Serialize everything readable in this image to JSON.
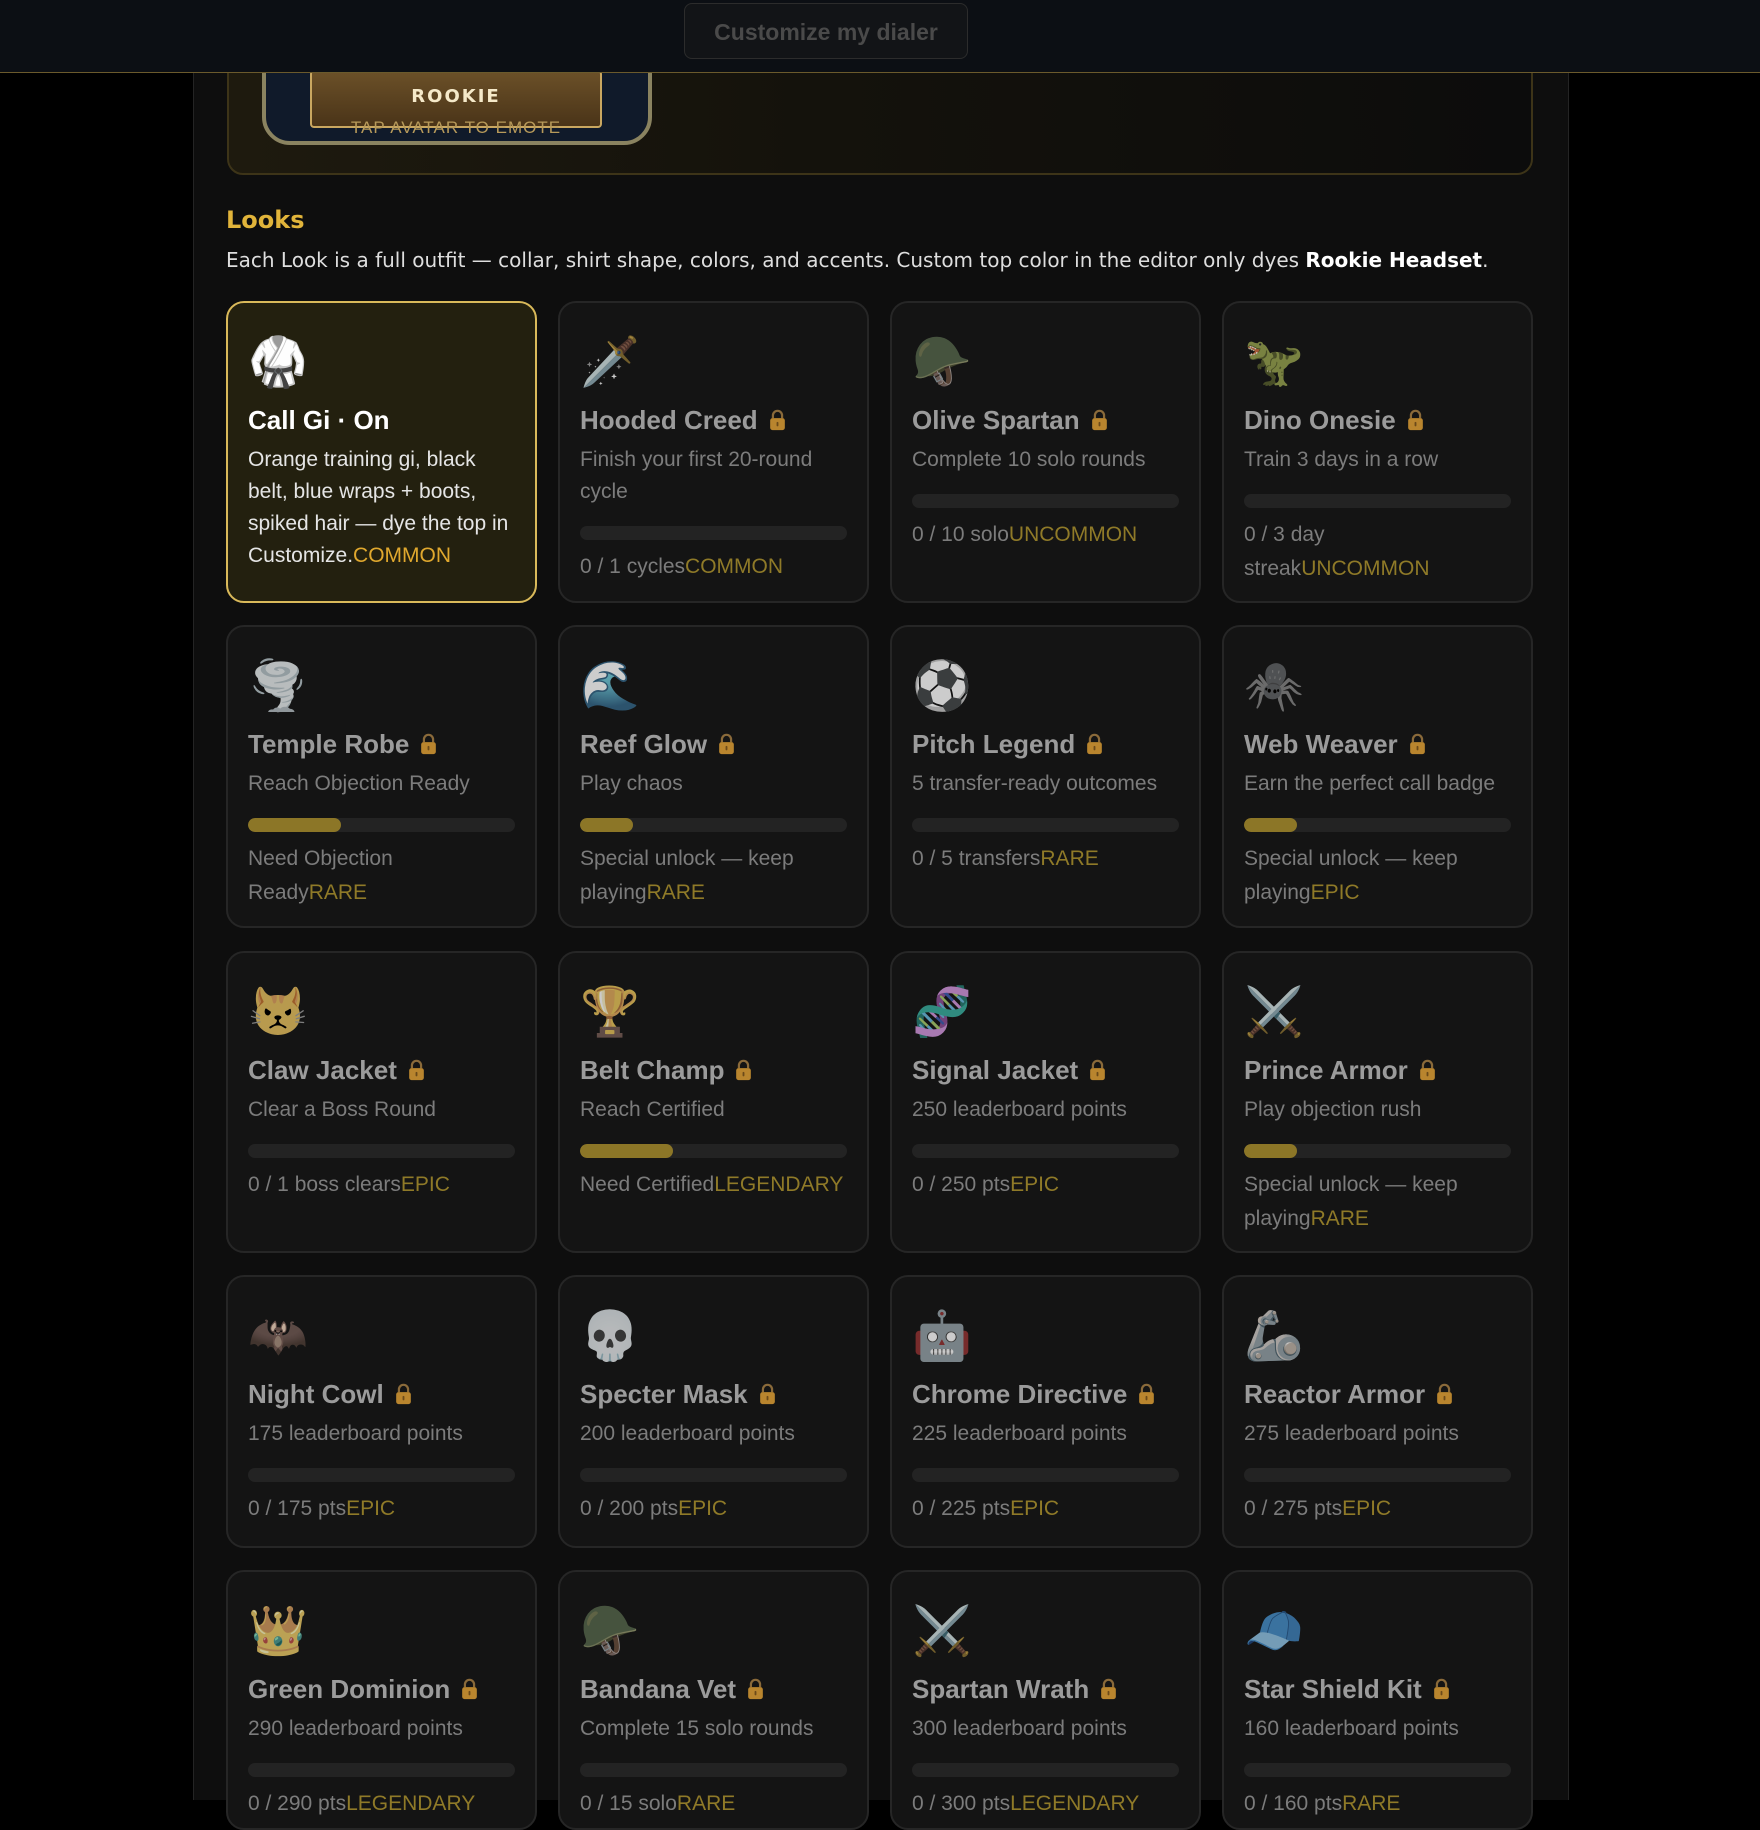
{
  "header": {
    "customize_button": "Customize my dialer"
  },
  "avatar": {
    "rank": "ROOKIE",
    "emote_hint": "TAP AVATAR TO EMOTE"
  },
  "looks": {
    "title": "Looks",
    "description_prefix": "Each Look is a full outfit — collar, shirt shape, colors, and accents. Custom top color in the editor only dyes ",
    "description_bold": "Rookie Headset",
    "description_suffix": ".",
    "items": [
      {
        "icon": "🥋",
        "icon_name": "martial-arts-uniform-icon",
        "name": "Call Gi · On",
        "req": "Orange training gi, black belt, blue wraps + boots, spiked hair — dye the top in Customize.",
        "status": "",
        "rarity": "COMMON",
        "locked": false,
        "active": true,
        "progress": null
      },
      {
        "icon": "🗡️",
        "icon_name": "dagger-icon",
        "name": "Hooded Creed",
        "req": "Finish your first 20-round cycle",
        "status": "0 / 1 cycles",
        "rarity": "COMMON",
        "locked": true,
        "active": false,
        "progress": 0
      },
      {
        "icon": "🪖",
        "icon_name": "military-helmet-icon",
        "name": "Olive Spartan",
        "req": "Complete 10 solo rounds",
        "status": "0 / 10 solo",
        "rarity": "UNCOMMON",
        "locked": true,
        "active": false,
        "progress": 0
      },
      {
        "icon": "🦖",
        "icon_name": "t-rex-icon",
        "name": "Dino Onesie",
        "req": "Train 3 days in a row",
        "status": "0 / 3 day streak",
        "rarity": "UNCOMMON",
        "locked": true,
        "active": false,
        "progress": 0
      },
      {
        "icon": "🌪️",
        "icon_name": "tornado-icon",
        "name": "Temple Robe",
        "req": "Reach Objection Ready",
        "status": "Need Objection Ready",
        "rarity": "RARE",
        "locked": true,
        "active": false,
        "progress": 0.35
      },
      {
        "icon": "🌊",
        "icon_name": "water-wave-icon",
        "name": "Reef Glow",
        "req": "Play chaos",
        "status": "Special unlock — keep playing",
        "rarity": "RARE",
        "locked": true,
        "active": false,
        "progress": 0.2
      },
      {
        "icon": "⚽",
        "icon_name": "soccer-ball-icon",
        "name": "Pitch Legend",
        "req": "5 transfer-ready outcomes",
        "status": "0 / 5 transfers",
        "rarity": "RARE",
        "locked": true,
        "active": false,
        "progress": 0
      },
      {
        "icon": "🕷️",
        "icon_name": "spider-icon",
        "name": "Web Weaver",
        "req": "Earn the perfect call badge",
        "status": "Special unlock — keep playing",
        "rarity": "EPIC",
        "locked": true,
        "active": false,
        "progress": 0.2
      },
      {
        "icon": "😾",
        "icon_name": "pouting-cat-icon",
        "name": "Claw Jacket",
        "req": "Clear a Boss Round",
        "status": "0 / 1 boss clears",
        "rarity": "EPIC",
        "locked": true,
        "active": false,
        "progress": 0
      },
      {
        "icon": "🏆",
        "icon_name": "trophy-icon",
        "name": "Belt Champ",
        "req": "Reach Certified",
        "status": "Need Certified",
        "rarity": "LEGENDARY",
        "locked": true,
        "active": false,
        "progress": 0.35
      },
      {
        "icon": "🧬",
        "icon_name": "dna-icon",
        "name": "Signal Jacket",
        "req": "250 leaderboard points",
        "status": "0 / 250 pts",
        "rarity": "EPIC",
        "locked": true,
        "active": false,
        "progress": 0
      },
      {
        "icon": "⚔️",
        "icon_name": "crossed-swords-icon",
        "name": "Prince Armor",
        "req": "Play objection rush",
        "status": "Special unlock — keep playing",
        "rarity": "RARE",
        "locked": true,
        "active": false,
        "progress": 0.2
      },
      {
        "icon": "🦇",
        "icon_name": "bat-icon",
        "name": "Night Cowl",
        "req": "175 leaderboard points",
        "status": "0 / 175 pts",
        "rarity": "EPIC",
        "locked": true,
        "active": false,
        "progress": 0
      },
      {
        "icon": "💀",
        "icon_name": "skull-icon",
        "name": "Specter Mask",
        "req": "200 leaderboard points",
        "status": "0 / 200 pts",
        "rarity": "EPIC",
        "locked": true,
        "active": false,
        "progress": 0
      },
      {
        "icon": "🤖",
        "icon_name": "robot-icon",
        "name": "Chrome Directive",
        "req": "225 leaderboard points",
        "status": "0 / 225 pts",
        "rarity": "EPIC",
        "locked": true,
        "active": false,
        "progress": 0
      },
      {
        "icon": "🦾",
        "icon_name": "mechanical-arm-icon",
        "name": "Reactor Armor",
        "req": "275 leaderboard points",
        "status": "0 / 275 pts",
        "rarity": "EPIC",
        "locked": true,
        "active": false,
        "progress": 0
      },
      {
        "icon": "👑",
        "icon_name": "crown-icon",
        "name": "Green Dominion",
        "req": "290 leaderboard points",
        "status": "0 / 290 pts",
        "rarity": "LEGENDARY",
        "locked": true,
        "active": false,
        "progress": 0
      },
      {
        "icon": "🪖",
        "icon_name": "military-helmet-icon",
        "name": "Bandana Vet",
        "req": "Complete 15 solo rounds",
        "status": "0 / 15 solo",
        "rarity": "RARE",
        "locked": true,
        "active": false,
        "progress": 0
      },
      {
        "icon": "⚔️",
        "icon_name": "crossed-swords-icon",
        "name": "Spartan Wrath",
        "req": "300 leaderboard points",
        "status": "0 / 300 pts",
        "rarity": "LEGENDARY",
        "locked": true,
        "active": false,
        "progress": 0
      },
      {
        "icon": "🧢",
        "icon_name": "cap-icon",
        "name": "Star Shield Kit",
        "req": "160 leaderboard points",
        "status": "0 / 160 pts",
        "rarity": "RARE",
        "locked": true,
        "active": false,
        "progress": 0
      }
    ]
  },
  "colors": {
    "accent": "#e1b43a",
    "active_border": "#d9b95a",
    "rarity_locked": "#8f7a28",
    "rarity_active": "#e0a82e",
    "progress_fill": "#8c7627"
  }
}
